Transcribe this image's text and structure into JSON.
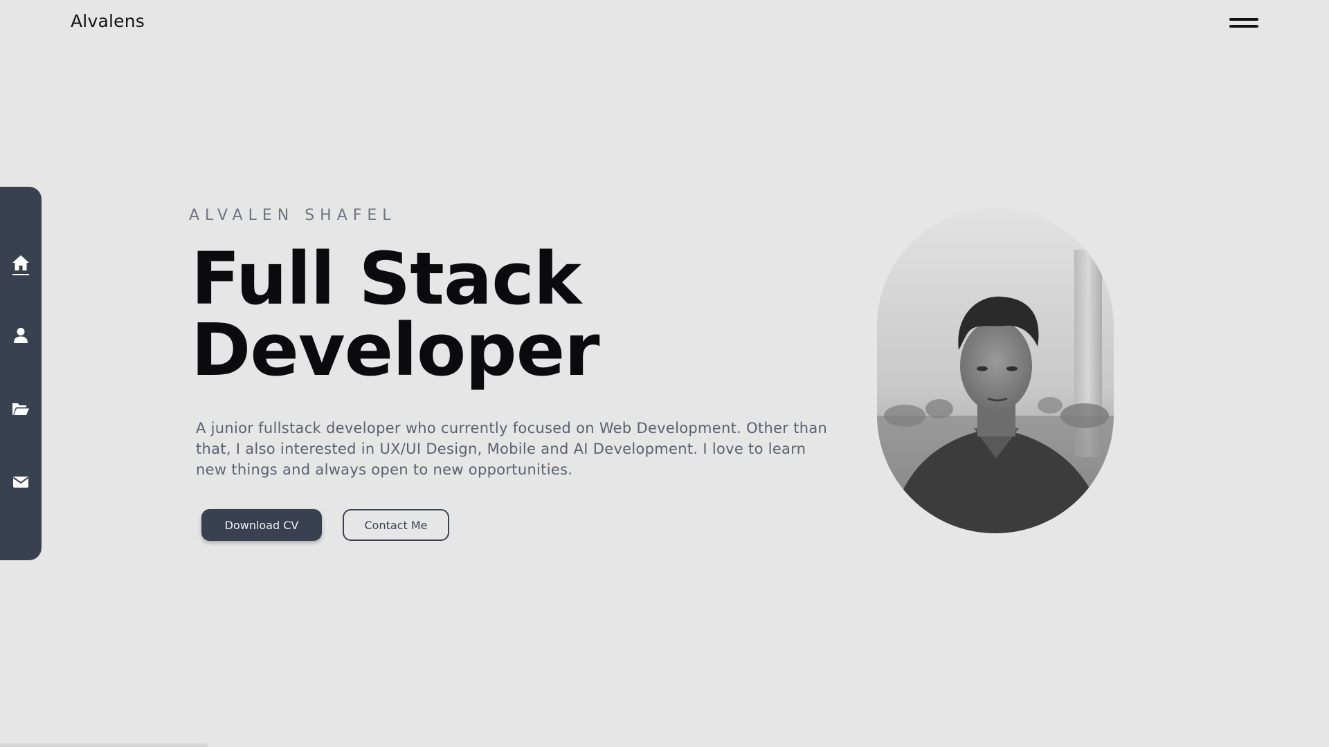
{
  "header": {
    "brand": "Alvalens",
    "menu_icon": "hamburger-icon"
  },
  "sidebar": {
    "items": [
      {
        "icon": "home-icon",
        "active": true
      },
      {
        "icon": "user-icon",
        "active": false
      },
      {
        "icon": "folder-open-icon",
        "active": false
      },
      {
        "icon": "envelope-icon",
        "active": false
      }
    ],
    "background_color": "#39404f"
  },
  "hero": {
    "eyebrow": "ALVALEN SHAFEL",
    "title_line1": "Full Stack",
    "title_line2": "Developer",
    "description": "A junior fullstack developer who currently focused on Web Development. Other than that, I also interested in UX/UI Design, Mobile and AI Development. I love to learn new things and always open to new opportunities.",
    "buttons": {
      "primary_label": "Download CV",
      "secondary_label": "Contact Me"
    }
  },
  "portrait": {
    "description_icon": "portrait-photo"
  },
  "colors": {
    "page_background": "#e6e6e6",
    "accent": "#39404f",
    "title": "#0b0b0d",
    "muted_text": "#5c6070"
  }
}
